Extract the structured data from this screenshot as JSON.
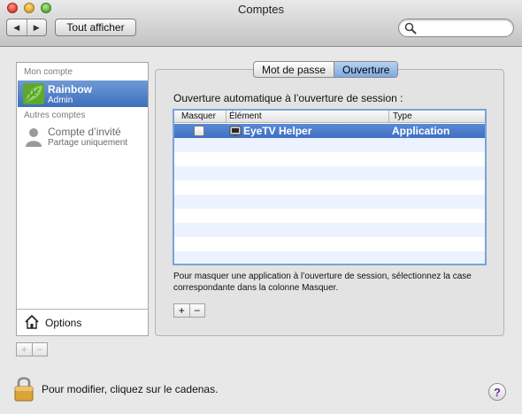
{
  "window": {
    "title": "Comptes"
  },
  "toolbar": {
    "back_icon": "back-arrow-icon",
    "forward_icon": "forward-arrow-icon",
    "show_all_label": "Tout afficher",
    "search_placeholder": ""
  },
  "sidebar": {
    "my_account_header": "Mon compte",
    "other_accounts_header": "Autres comptes",
    "accounts": [
      {
        "name": "Rainbow",
        "role": "Admin",
        "avatar": "leaf-avatar-icon",
        "selected": true
      },
      {
        "name": "Compte d’invité",
        "role": "Partage uniquement",
        "avatar": "guest-silhouette-icon",
        "selected": false
      }
    ],
    "options_label": "Options"
  },
  "tabs": [
    {
      "label": "Mot de passe",
      "active": false
    },
    {
      "label": "Ouverture",
      "active": true
    }
  ],
  "login_items": {
    "heading": "Ouverture automatique à l’ouverture de session :",
    "columns": [
      "Masquer",
      "Élément",
      "Type"
    ],
    "rows": [
      {
        "hide": false,
        "item": "EyeTV Helper",
        "type": "Application",
        "selected": true
      }
    ],
    "help_text": "Pour masquer une application à l’ouverture de session, sélectionnez la case correspondante dans la colonne Masquer."
  },
  "footer": {
    "lock_text": "Pour modifier, cliquez sur le cadenas.",
    "help_label": "?"
  },
  "colors": {
    "selection": "#3e6fbd",
    "active_tab": "#7ea9e3",
    "row_alt": "#edf3fe"
  }
}
